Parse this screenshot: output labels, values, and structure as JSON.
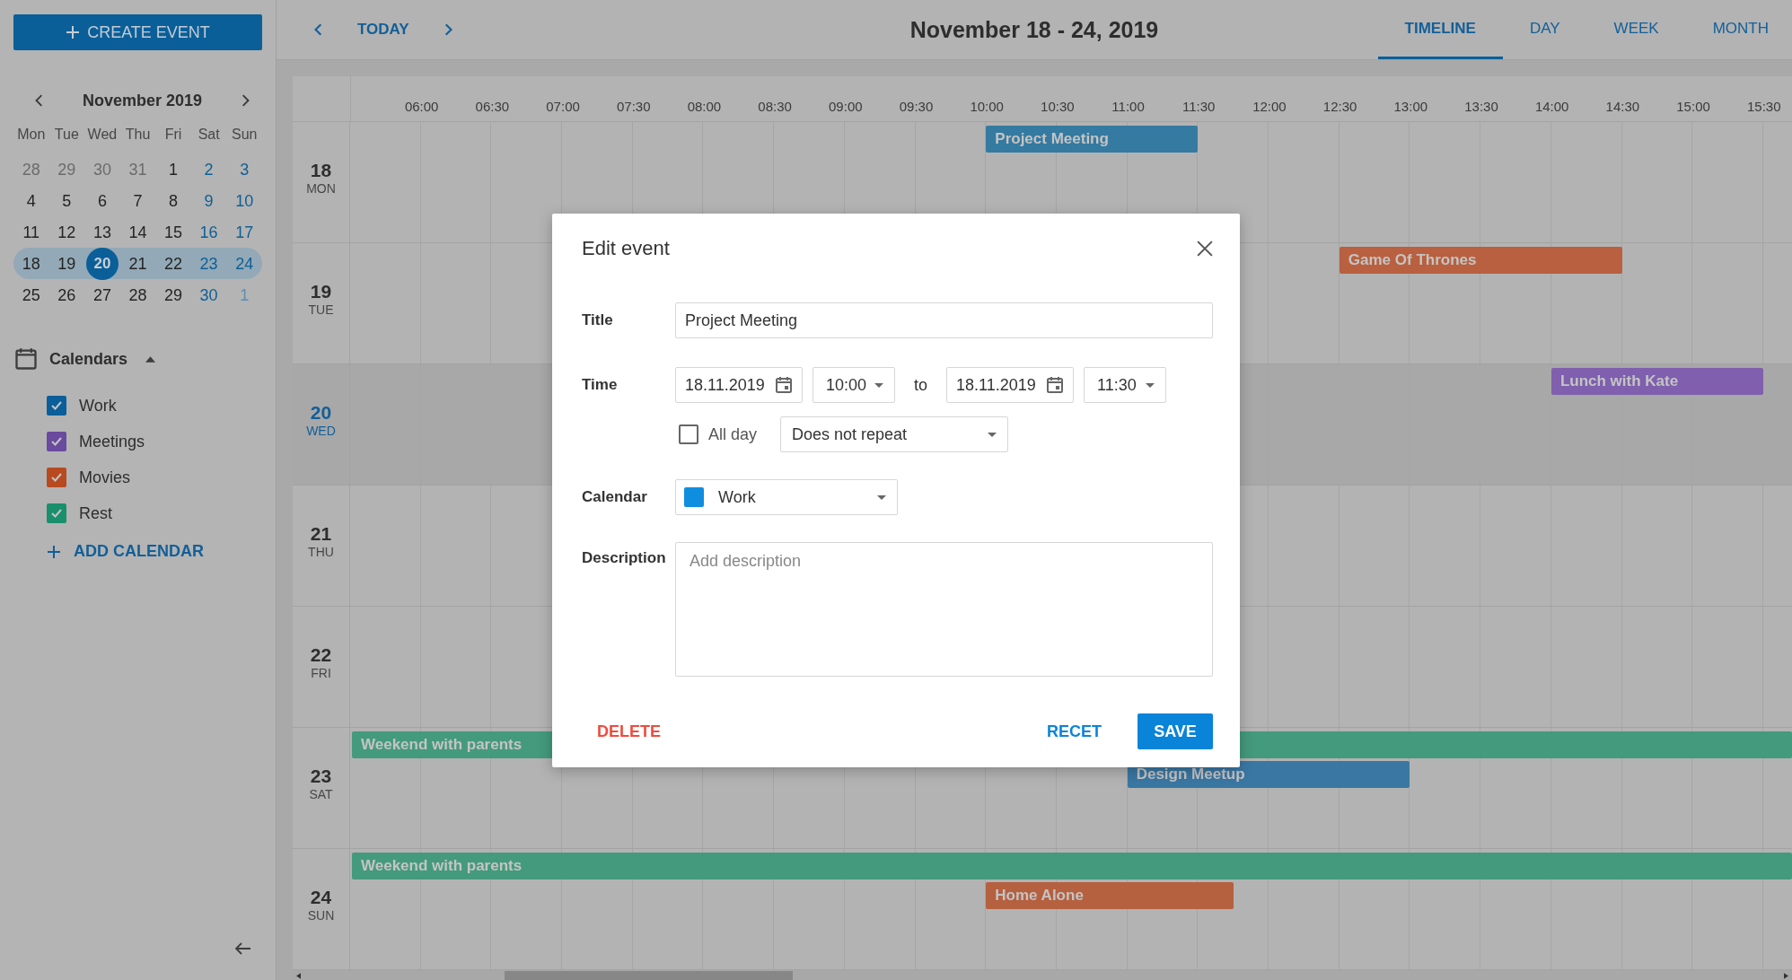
{
  "sidebar": {
    "create_button": "CREATE EVENT",
    "mini_calendar": {
      "month": "November 2019",
      "weekdays": [
        "Mon",
        "Tue",
        "Wed",
        "Thu",
        "Fri",
        "Sat",
        "Sun"
      ],
      "weeks": [
        {
          "selected": false,
          "days": [
            {
              "text": "28",
              "outside": true,
              "weekend": false,
              "selected": false
            },
            {
              "text": "29",
              "outside": true,
              "weekend": false,
              "selected": false
            },
            {
              "text": "30",
              "outside": true,
              "weekend": false,
              "selected": false
            },
            {
              "text": "31",
              "outside": true,
              "weekend": false,
              "selected": false
            },
            {
              "text": "1",
              "outside": false,
              "weekend": false,
              "selected": false
            },
            {
              "text": "2",
              "outside": false,
              "weekend": true,
              "selected": false
            },
            {
              "text": "3",
              "outside": false,
              "weekend": true,
              "selected": false
            }
          ]
        },
        {
          "selected": false,
          "days": [
            {
              "text": "4",
              "outside": false,
              "weekend": false,
              "selected": false
            },
            {
              "text": "5",
              "outside": false,
              "weekend": false,
              "selected": false
            },
            {
              "text": "6",
              "outside": false,
              "weekend": false,
              "selected": false
            },
            {
              "text": "7",
              "outside": false,
              "weekend": false,
              "selected": false
            },
            {
              "text": "8",
              "outside": false,
              "weekend": false,
              "selected": false
            },
            {
              "text": "9",
              "outside": false,
              "weekend": true,
              "selected": false
            },
            {
              "text": "10",
              "outside": false,
              "weekend": true,
              "selected": false
            }
          ]
        },
        {
          "selected": false,
          "days": [
            {
              "text": "11",
              "outside": false,
              "weekend": false,
              "selected": false
            },
            {
              "text": "12",
              "outside": false,
              "weekend": false,
              "selected": false
            },
            {
              "text": "13",
              "outside": false,
              "weekend": false,
              "selected": false
            },
            {
              "text": "14",
              "outside": false,
              "weekend": false,
              "selected": false
            },
            {
              "text": "15",
              "outside": false,
              "weekend": false,
              "selected": false
            },
            {
              "text": "16",
              "outside": false,
              "weekend": true,
              "selected": false
            },
            {
              "text": "17",
              "outside": false,
              "weekend": true,
              "selected": false
            }
          ]
        },
        {
          "selected": true,
          "days": [
            {
              "text": "18",
              "outside": false,
              "weekend": false,
              "selected": false
            },
            {
              "text": "19",
              "outside": false,
              "weekend": false,
              "selected": false
            },
            {
              "text": "20",
              "outside": false,
              "weekend": false,
              "selected": true
            },
            {
              "text": "21",
              "outside": false,
              "weekend": false,
              "selected": false
            },
            {
              "text": "22",
              "outside": false,
              "weekend": false,
              "selected": false
            },
            {
              "text": "23",
              "outside": false,
              "weekend": true,
              "selected": false
            },
            {
              "text": "24",
              "outside": false,
              "weekend": true,
              "selected": false
            }
          ]
        },
        {
          "selected": false,
          "days": [
            {
              "text": "25",
              "outside": false,
              "weekend": false,
              "selected": false
            },
            {
              "text": "26",
              "outside": false,
              "weekend": false,
              "selected": false
            },
            {
              "text": "27",
              "outside": false,
              "weekend": false,
              "selected": false
            },
            {
              "text": "28",
              "outside": false,
              "weekend": false,
              "selected": false
            },
            {
              "text": "29",
              "outside": false,
              "weekend": false,
              "selected": false
            },
            {
              "text": "30",
              "outside": false,
              "weekend": true,
              "selected": false
            },
            {
              "text": "1",
              "outside": true,
              "weekend": true,
              "selected": false
            }
          ]
        }
      ]
    },
    "calendars": {
      "title": "Calendars",
      "expanded": true,
      "items": [
        {
          "label": "Work",
          "checked": true,
          "color": "#0a5f9a"
        },
        {
          "label": "Meetings",
          "checked": true,
          "color": "#6a4a9e"
        },
        {
          "label": "Movies",
          "checked": true,
          "color": "#b84a20"
        },
        {
          "label": "Rest",
          "checked": true,
          "color": "#1a8f6c"
        }
      ],
      "add_button": "ADD CALENDAR"
    }
  },
  "toolbar": {
    "today_button": "TODAY",
    "title": "November 18 - 24, 2019",
    "tabs": [
      {
        "label": "TIMELINE",
        "selected": true
      },
      {
        "label": "DAY",
        "selected": false
      },
      {
        "label": "WEEK",
        "selected": false
      },
      {
        "label": "MONTH",
        "selected": false
      }
    ]
  },
  "timeline": {
    "times": [
      "06:00",
      "06:30",
      "07:00",
      "07:30",
      "08:00",
      "08:30",
      "09:00",
      "09:30",
      "10:00",
      "10:30",
      "11:00",
      "11:30",
      "12:00",
      "12:30",
      "13:00",
      "13:30",
      "14:00",
      "14:30",
      "15:00",
      "15:30"
    ],
    "days": [
      {
        "number": "18",
        "weekday": "MON",
        "selected": false,
        "events": [
          {
            "title": "Project Meeting",
            "all_day": false,
            "color": "#357aa0"
          }
        ]
      },
      {
        "number": "19",
        "weekday": "TUE",
        "selected": false,
        "events": [
          {
            "title": "Game Of Thrones",
            "all_day": false,
            "color": "#b8603f"
          }
        ]
      },
      {
        "number": "20",
        "weekday": "WED",
        "selected": true,
        "events": [
          {
            "title": "Lunch with Kate",
            "all_day": false,
            "color": "#7f5fae"
          }
        ]
      },
      {
        "number": "21",
        "weekday": "THU",
        "selected": false
      },
      {
        "number": "22",
        "weekday": "FRI",
        "selected": false
      },
      {
        "number": "23",
        "weekday": "SAT",
        "selected": false,
        "events": [
          {
            "title": "Weekend with parents",
            "all_day": true,
            "color": "#449a7c"
          },
          {
            "title": "Design Meetup",
            "all_day": false,
            "color": "#3a77a3"
          }
        ]
      },
      {
        "number": "24",
        "weekday": "SUN",
        "selected": false,
        "events": [
          {
            "title": "Weekend with parents",
            "all_day": true,
            "color": "#449a7c"
          },
          {
            "title": "Home Alone",
            "all_day": false,
            "color": "#b5603f"
          }
        ]
      }
    ]
  },
  "dialog": {
    "title": "Edit event",
    "title_label": "Title",
    "title_value": "Project Meeting",
    "time_label": "Time",
    "start_date": "18.11.2019",
    "start_time": "10:00",
    "to_label": "to",
    "end_date": "18.11.2019",
    "end_time": "11:30",
    "all_day": {
      "label": "All day",
      "checked": false
    },
    "repeat": "Does not repeat",
    "calendar_label": "Calendar",
    "calendar": {
      "value": "Work",
      "color": "#0f8ee0"
    },
    "description_label": "Description",
    "description_placeholder": "Add description",
    "buttons": {
      "delete": "DELETE",
      "reset": "RECET",
      "save": "SAVE"
    }
  }
}
